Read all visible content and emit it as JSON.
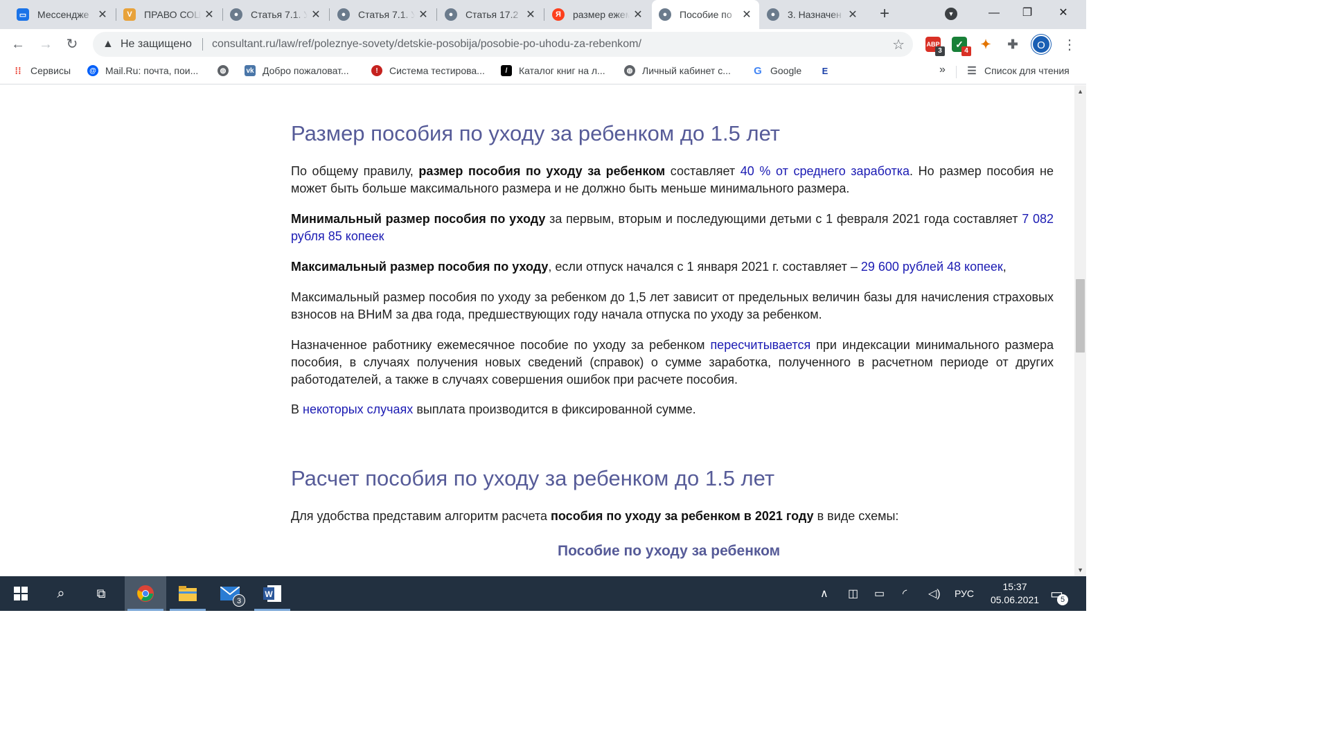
{
  "browser": {
    "tabs": [
      {
        "title": "Мессендже",
        "favicon": "chat-icon",
        "favicon_color": "#1a73e8"
      },
      {
        "title": "ПРАВО СОЦ",
        "favicon": "law-icon",
        "favicon_color": "#e8a23a"
      },
      {
        "title": "Статья 7.1. У",
        "favicon": "person-icon",
        "favicon_color": "#6b7b8c"
      },
      {
        "title": "Статья 7.1. У",
        "favicon": "person-icon",
        "favicon_color": "#6b7b8c"
      },
      {
        "title": "Статья 17.2",
        "favicon": "person-icon",
        "favicon_color": "#6b7b8c"
      },
      {
        "title": "размер ежем",
        "favicon": "yandex-icon",
        "favicon_color": "#fc3f1d"
      },
      {
        "title": "Пособие по",
        "favicon": "person-icon",
        "favicon_color": "#6b7b8c",
        "active": true
      },
      {
        "title": "3. Назначен",
        "favicon": "person-icon",
        "favicon_color": "#6b7b8c"
      }
    ],
    "new_tab_symbol": "+",
    "security_label": "Не защищено",
    "url": "consultant.ru/law/ref/poleznye-sovety/detskie-posobija/posobie-po-uhodu-za-rebenkom/",
    "extensions": [
      {
        "name": "abp-extension-icon",
        "label": "ABP",
        "badge": "3",
        "color": "#d93025"
      },
      {
        "name": "check-extension-icon",
        "label": "✓",
        "badge": "4",
        "color": "#188038"
      },
      {
        "name": "star-extension-icon",
        "label": "✦",
        "badge": "",
        "color": "#e37400"
      }
    ],
    "profile_initial": "O",
    "bookmarks": [
      {
        "label": "Сервисы",
        "icon": "apps-grid-icon",
        "color": "#ea4335"
      },
      {
        "label": "Mail.Ru: почта, пои...",
        "icon": "mailru-icon",
        "color": "#005ff9"
      },
      {
        "label": "",
        "icon": "globe-icon",
        "color": "#5f6368"
      },
      {
        "label": "Добро пожаловат...",
        "icon": "vk-icon",
        "color": "#4a76a8"
      },
      {
        "label": "Система тестирова...",
        "icon": "test-system-icon",
        "color": "#c5221f"
      },
      {
        "label": "Каталог книг на л...",
        "icon": "books-icon",
        "color": "#000000"
      },
      {
        "label": "Личный кабинет с...",
        "icon": "globe-icon",
        "color": "#5f6368"
      },
      {
        "label": "Google",
        "icon": "google-icon",
        "color": "#4285f4"
      },
      {
        "label": "",
        "icon": "e-icon",
        "color": "#1a3fa8"
      }
    ],
    "bookmarks_more": "»",
    "reading_list": "Список для чтения"
  },
  "page": {
    "section1_title": "Размер пособия по уходу за ребенком до 1.5 лет",
    "p1": {
      "t1": "По общему правилу, ",
      "b1": "размер пособия по уходу за ребенком",
      "t2": " составляет ",
      "l1": "40 % от среднего заработка",
      "t3": ". Но размер пособия не может быть больше максимального размера и не должно быть меньше минимального размера."
    },
    "p2": {
      "b1": "Минимальный размер пособия по уходу",
      "t1": " за первым, вторым и последующими детьми с 1 февраля 2021 года  составляет ",
      "l1": "7 082 рубля 85 копеек"
    },
    "p3": {
      "b1": "Максимальный размер пособия по уходу",
      "t1": ", если отпуск начался с 1 января 2021 г. составляет – ",
      "l1": "29 600 рублей 48 копеек",
      "t2": ","
    },
    "p4": "Максимальный размер пособия по уходу за ребенком до 1,5 лет зависит от предельных величин базы для начисления страховых взносов на ВНиМ за два года, предшествующих году начала отпуска по уходу за ребенком.",
    "p5": {
      "t1": "Назначенное работнику ежемесячное пособие по уходу за ребенком ",
      "l1": "пересчитывается",
      "t2": " при индексации минимального размера пособия, в случаях получения новых сведений (справок) о сумме заработка, полученного в расчетном периоде от других работодателей, а также в случаях совершения ошибок при расчете пособия."
    },
    "p6": {
      "t1": "В ",
      "l1": "некоторых случаях",
      "t2": " выплата производится в фиксированной сумме."
    },
    "section2_title": "Расчет пособия по уходу за ребенком до 1.5 лет",
    "p7": {
      "t1": "Для удобства представим алгоритм расчета ",
      "b1": "пособия по уходу за ребенком в 2021 году",
      "t2": " в виде схемы:"
    },
    "scheme_title": "Пособие по уходу за ребенком"
  },
  "taskbar": {
    "mail_badge": "3",
    "language": "РУС",
    "time": "15:37",
    "date": "05.06.2021",
    "notifications_count": "5"
  },
  "colors": {
    "heading": "#565b98",
    "link": "#1b1bb3",
    "taskbar": "#223040"
  }
}
